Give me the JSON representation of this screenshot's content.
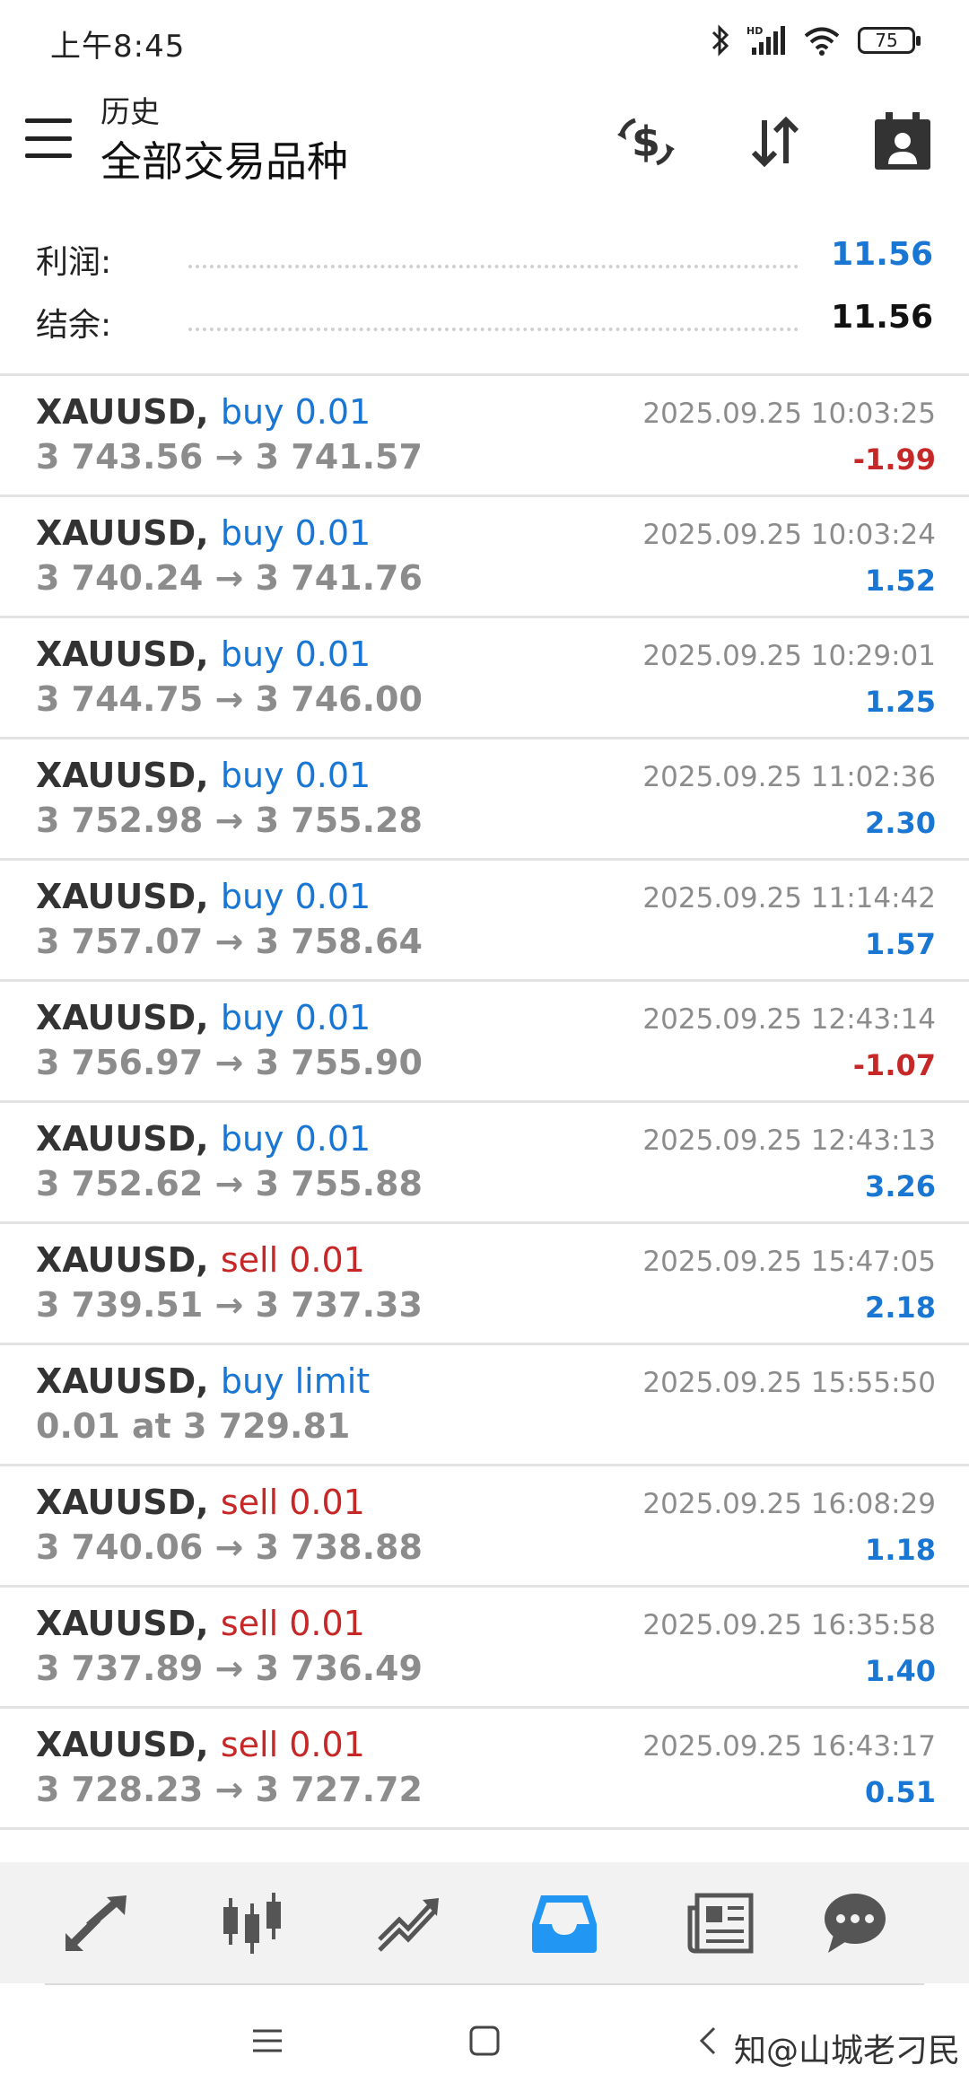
{
  "status_bar": {
    "time": "上午8:45",
    "battery": "75"
  },
  "header": {
    "subtitle": "历史",
    "title": "全部交易品种"
  },
  "summary": {
    "profit_label": "利润:",
    "profit_value": "11.56",
    "balance_label": "结余:",
    "balance_value": "11.56"
  },
  "colors": {
    "blue": "#1976d2",
    "red": "#c62828",
    "active_nav": "#2196f3"
  },
  "trades": [
    {
      "symbol": "XAUUSD,",
      "action": "buy 0.01",
      "type": "buy",
      "prices": "3 743.56 → 3 741.57",
      "time": "2025.09.25 10:03:25",
      "profit": "-1.99"
    },
    {
      "symbol": "XAUUSD,",
      "action": "buy 0.01",
      "type": "buy",
      "prices": "3 740.24 → 3 741.76",
      "time": "2025.09.25 10:03:24",
      "profit": "1.52"
    },
    {
      "symbol": "XAUUSD,",
      "action": "buy 0.01",
      "type": "buy",
      "prices": "3 744.75 → 3 746.00",
      "time": "2025.09.25 10:29:01",
      "profit": "1.25"
    },
    {
      "symbol": "XAUUSD,",
      "action": "buy 0.01",
      "type": "buy",
      "prices": "3 752.98 → 3 755.28",
      "time": "2025.09.25 11:02:36",
      "profit": "2.30"
    },
    {
      "symbol": "XAUUSD,",
      "action": "buy 0.01",
      "type": "buy",
      "prices": "3 757.07 → 3 758.64",
      "time": "2025.09.25 11:14:42",
      "profit": "1.57"
    },
    {
      "symbol": "XAUUSD,",
      "action": "buy 0.01",
      "type": "buy",
      "prices": "3 756.97 → 3 755.90",
      "time": "2025.09.25 12:43:14",
      "profit": "-1.07"
    },
    {
      "symbol": "XAUUSD,",
      "action": "buy 0.01",
      "type": "buy",
      "prices": "3 752.62 → 3 755.88",
      "time": "2025.09.25 12:43:13",
      "profit": "3.26"
    },
    {
      "symbol": "XAUUSD,",
      "action": "sell 0.01",
      "type": "sell",
      "prices": "3 739.51 → 3 737.33",
      "time": "2025.09.25 15:47:05",
      "profit": "2.18"
    },
    {
      "symbol": "XAUUSD,",
      "action": "buy limit",
      "type": "buy",
      "prices": "0.01 at 3 729.81",
      "time": "2025.09.25 15:55:50",
      "profit": ""
    },
    {
      "symbol": "XAUUSD,",
      "action": "sell 0.01",
      "type": "sell",
      "prices": "3 740.06 → 3 738.88",
      "time": "2025.09.25 16:08:29",
      "profit": "1.18"
    },
    {
      "symbol": "XAUUSD,",
      "action": "sell 0.01",
      "type": "sell",
      "prices": "3 737.89 → 3 736.49",
      "time": "2025.09.25 16:35:58",
      "profit": "1.40"
    },
    {
      "symbol": "XAUUSD,",
      "action": "sell 0.01",
      "type": "sell",
      "prices": "3 728.23 → 3 727.72",
      "time": "2025.09.25 16:43:17",
      "profit": "0.51"
    }
  ],
  "bottom_nav": [
    {
      "icon": "quotes-icon"
    },
    {
      "icon": "chart-icon"
    },
    {
      "icon": "trade-icon"
    },
    {
      "icon": "history-icon",
      "active": true
    },
    {
      "icon": "news-icon"
    },
    {
      "icon": "messages-icon"
    }
  ],
  "watermark": "知@山城老刁民"
}
